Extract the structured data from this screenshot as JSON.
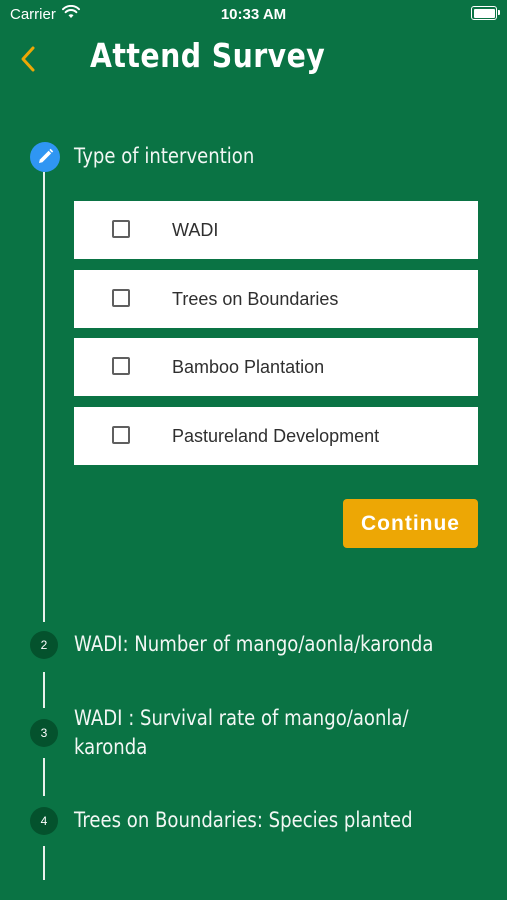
{
  "status_bar": {
    "carrier": "Carrier",
    "time": "10:33 AM"
  },
  "header": {
    "title": "Attend Survey"
  },
  "active_step": {
    "label": "Type of intervention",
    "options": [
      {
        "label": "WADI",
        "checked": false
      },
      {
        "label": "Trees on Boundaries",
        "checked": false
      },
      {
        "label": "Bamboo Plantation",
        "checked": false
      },
      {
        "label": "Pastureland Development",
        "checked": false
      }
    ],
    "continue_label": "Continue"
  },
  "steps": [
    {
      "number": "2",
      "label": "WADI: Number of mango/aonla/karonda"
    },
    {
      "number": "3",
      "label_line1": "WADI : Survival rate of mango/aonla/",
      "label_line2": "karonda"
    },
    {
      "number": "4",
      "label": "Trees on Boundaries: Species planted"
    }
  ],
  "colors": {
    "background": "#0a7344",
    "accent": "#eda705",
    "active_step": "#2f96f3",
    "step_circle": "#04522d"
  },
  "icons": {
    "back": "chevron-left-icon",
    "active_step": "pencil-icon",
    "wifi": "wifi-icon",
    "battery": "battery-icon"
  }
}
